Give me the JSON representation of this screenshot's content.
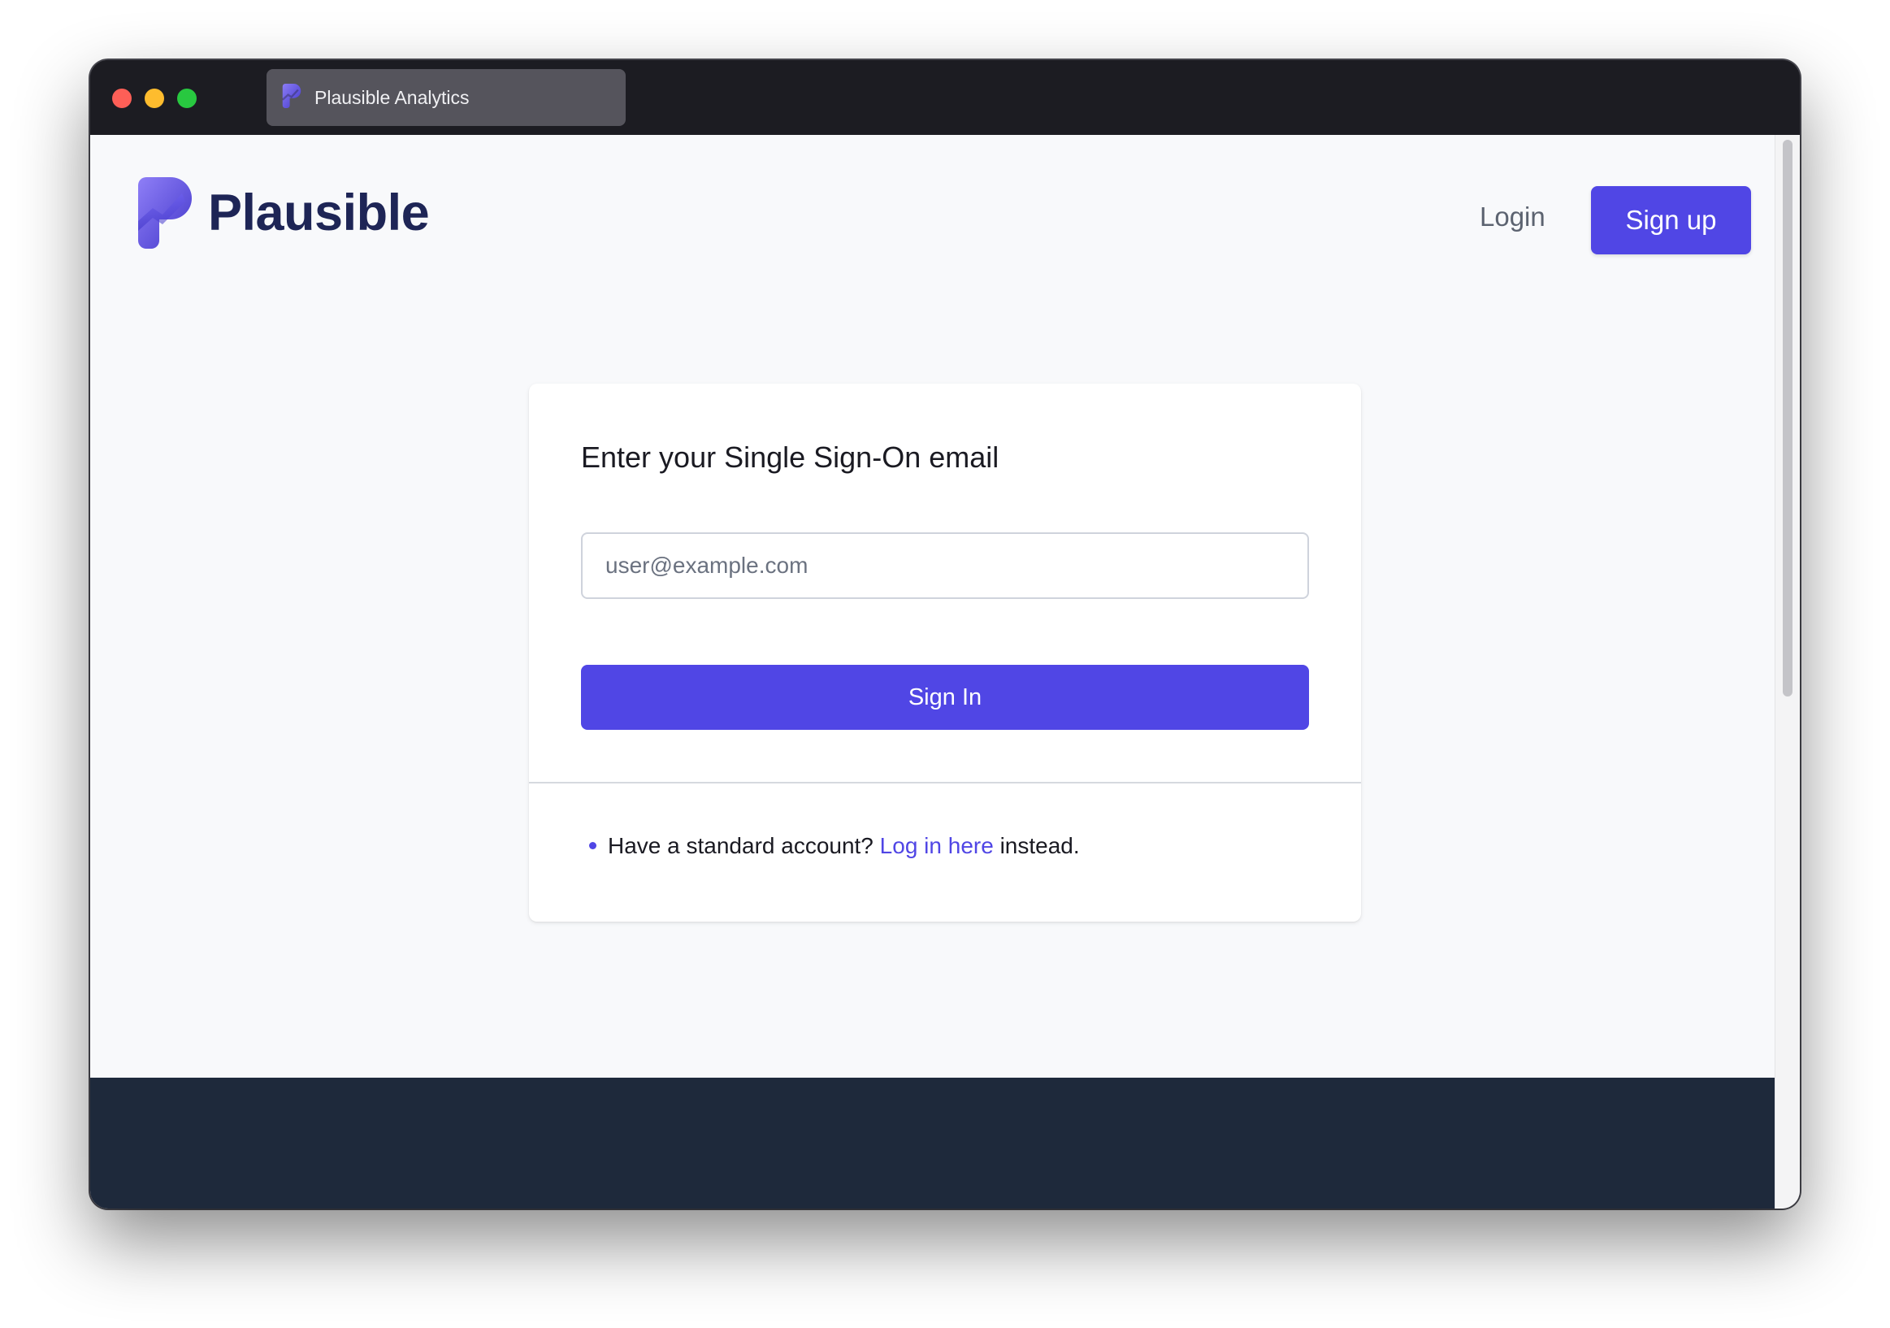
{
  "browser": {
    "tab_title": "Plausible Analytics"
  },
  "header": {
    "brand": "Plausible",
    "login_label": "Login",
    "signup_label": "Sign up"
  },
  "card": {
    "title": "Enter your Single Sign-On email",
    "email_placeholder": "user@example.com",
    "email_value": "",
    "submit_label": "Sign In",
    "note_prefix": "Have a standard account?",
    "note_link": "Log in here",
    "note_suffix": "instead."
  },
  "colors": {
    "accent": "#5046e5",
    "brand_text": "#1e2556",
    "footer_band": "#1e293b",
    "page_bg": "#f8f9fb"
  },
  "icons": {
    "favicon": "plausible-logo-icon",
    "logo": "plausible-logo-icon",
    "bullet": "bullet-dot-icon"
  }
}
